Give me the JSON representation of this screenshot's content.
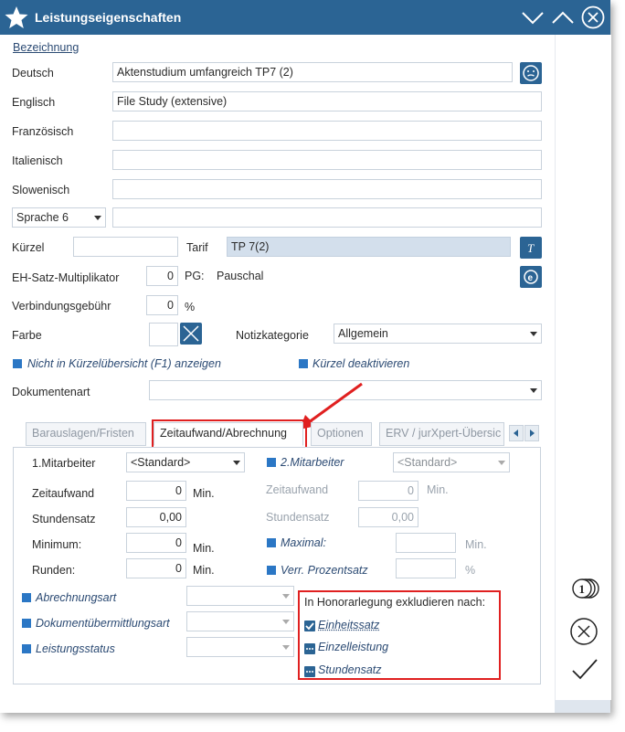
{
  "window": {
    "title": "Leistungseigenschaften"
  },
  "form": {
    "bezeichnung_label": "Bezeichnung",
    "deutsch_label": "Deutsch",
    "deutsch_value": "Aktenstudium umfangreich TP7 (2)",
    "englisch_label": "Englisch",
    "englisch_value": "File Study (extensive)",
    "franzoesisch_label": "Französisch",
    "franzoesisch_value": "",
    "italienisch_label": "Italienisch",
    "italienisch_value": "",
    "slowenisch_label": "Slowenisch",
    "slowenisch_value": "",
    "sprache_select": "Sprache 6",
    "sprache_value": "",
    "kuerzel_label": "Kürzel",
    "kuerzel_value": "",
    "tarif_label": "Tarif",
    "tarif_value": "TP 7(2)",
    "eh_label": "EH-Satz-Multiplikator",
    "eh_value": "0",
    "pg_label": "PG:",
    "pg_value": "Pauschal",
    "verbindung_label": "Verbindungsgebühr",
    "verbindung_value": "0",
    "percent": "%",
    "farbe_label": "Farbe",
    "notiz_label": "Notizkategorie",
    "notiz_value": "Allgemein",
    "nicht_in_kuerzel": "Nicht in Kürzelübersicht (F1) anzeigen",
    "kuerzel_deaktivieren": "Kürzel deaktivieren",
    "dokumentenart_label": "Dokumentenart",
    "dokumentenart_value": ""
  },
  "tabs": [
    {
      "label": "Barauslagen/Fristen"
    },
    {
      "label": "Zeitaufwand/Abrechnung"
    },
    {
      "label": "Optionen"
    },
    {
      "label": "ERV / jurXpert-Übersic"
    }
  ],
  "tabpanel": {
    "mitarbeiter1_label": "1.Mitarbeiter",
    "mitarbeiter1_value": "<Standard>",
    "mitarbeiter2_label": "2.Mitarbeiter",
    "mitarbeiter2_value": "<Standard>",
    "zeitaufwand_label": "Zeitaufwand",
    "zeitaufwand_value": "0",
    "zeitaufwand2_label": "Zeitaufwand",
    "zeitaufwand2_value": "0",
    "min": "Min.",
    "stundensatz_label": "Stundensatz",
    "stundensatz_value": "0,00",
    "stundensatz2_label": "Stundensatz",
    "stundensatz2_value": "0,00",
    "minimum_label": "Minimum:",
    "minimum_value": "0",
    "maximal_label": "Maximal:",
    "maximal_value": "",
    "runden_label": "Runden:",
    "runden_value": "0",
    "verr_label": "Verr. Prozentsatz",
    "verr_value": "",
    "abrechnungsart_label": "Abrechnungsart",
    "dokumentuebermittlung_label": "Dokumentübermittlungsart",
    "leistungsstatus_label": "Leistungsstatus",
    "honorar_title": "In Honorarlegung exkludieren nach:",
    "einheitssatz": "Einheitssatz",
    "einzelleistung": "Einzelleistung",
    "stundensatz_opt": "Stundensatz"
  },
  "colors": {
    "titlebar": "#2b6494",
    "accent": "#2b77c5",
    "highlight": "#e02020"
  }
}
